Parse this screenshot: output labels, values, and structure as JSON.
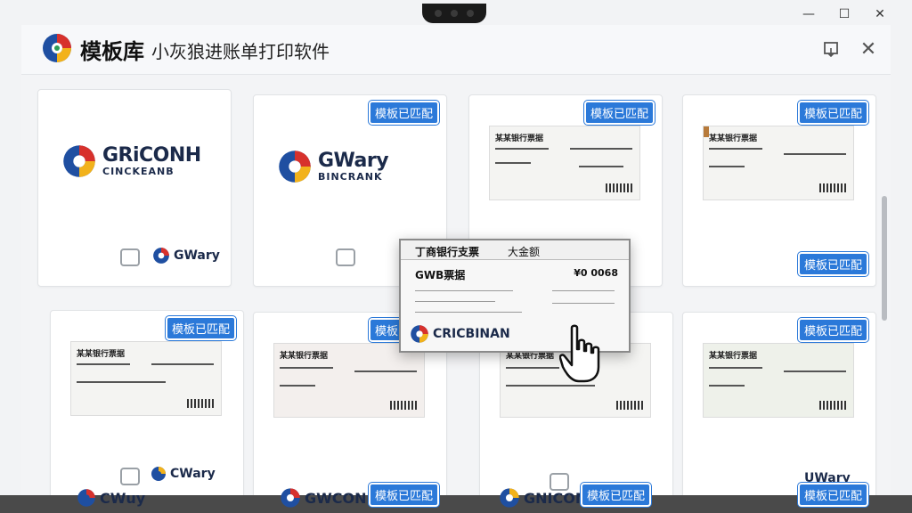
{
  "app": {
    "title_main": "模板库",
    "title_sub": "小灰狼进账单打印软件"
  },
  "window_controls": {
    "minimize": "—",
    "maximize": "☐",
    "close": "✕"
  },
  "header_icons": {
    "export": "export-icon",
    "close": "✕"
  },
  "badge_label": "模板已匹配",
  "cards": [
    {
      "brand_name": "GRiCONH",
      "brand_sub": "CINCKEANB",
      "mini_brand": "GWary"
    },
    {
      "brand_name": "GWary",
      "brand_sub": "BINCRANK"
    },
    {
      "ticket_title": "某某银行票据"
    },
    {
      "ticket_title": "某某银行票据"
    },
    {
      "ticket_title": "某某银行票据"
    },
    {
      "ticket_title": "某某银行票据"
    },
    {
      "ticket_title": "某某银行票据"
    },
    {
      "ticket_title": "某某银行票据"
    }
  ],
  "card_row2_bottom": {
    "mini_brand_1": "CWary",
    "mini_brand_2": "UWary"
  },
  "popup": {
    "bank": "丁商银行支票",
    "type": "大金额",
    "number": "GWB票据",
    "code": "¥0 0068",
    "brand": "CRICBINAN"
  },
  "bottom_row": {
    "b1": "GWCONH",
    "b2": "GNICONH",
    "b3": "CWuy"
  },
  "colors": {
    "badge": "#2b79d9",
    "brand_navy": "#1b2a4a",
    "logo_red": "#d7312c",
    "logo_blue": "#1f4fa1",
    "logo_yellow": "#f2b21b",
    "logo_green": "#2e9d57"
  }
}
